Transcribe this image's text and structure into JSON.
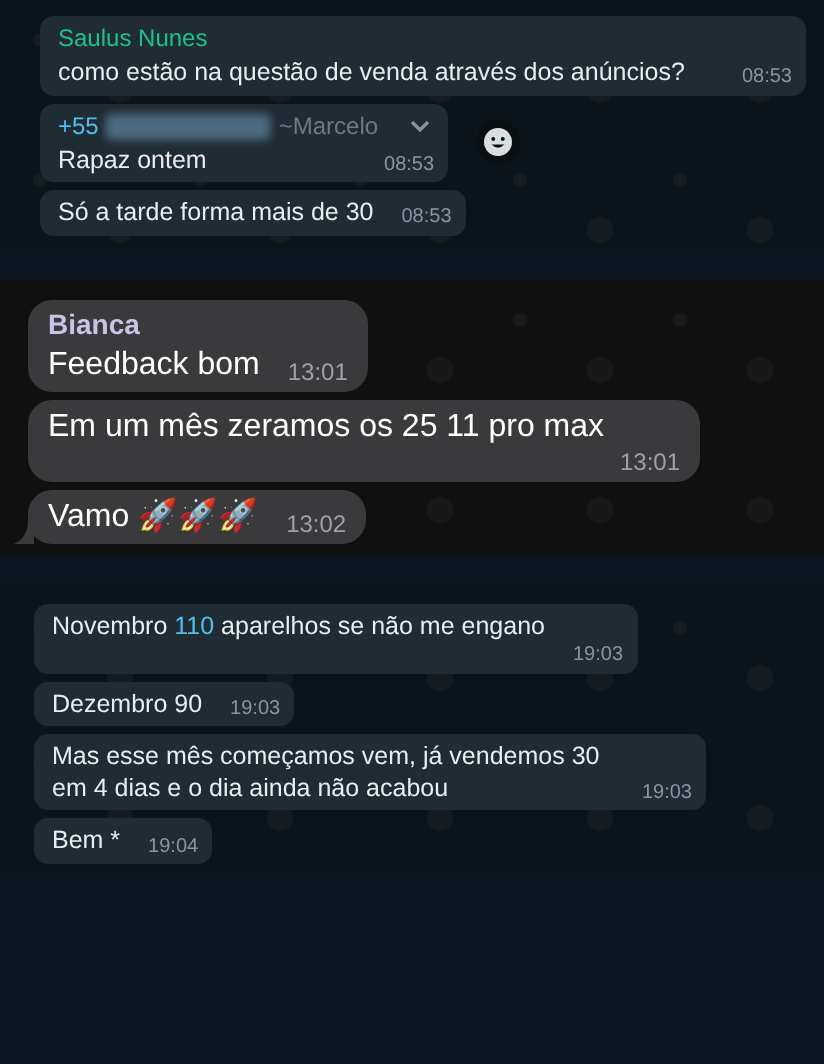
{
  "screenshots": [
    {
      "kind": "android",
      "messages": [
        {
          "sender": {
            "name": "Saulus Nunes",
            "color": "#21c08b"
          },
          "parts": [
            {
              "text": "como estão na questão de venda através dos anúncios?"
            }
          ],
          "time": "08:53",
          "wide": true
        },
        {
          "sender": {
            "name": "+55",
            "color": "#53bdeb",
            "redacted": true,
            "alias": "~Marcelo"
          },
          "parts": [
            {
              "text": "Rapaz ontem"
            }
          ],
          "time": "08:53",
          "menu": true,
          "reaction_button": true
        },
        {
          "parts": [
            {
              "text": "Só a tarde forma mais de 30"
            }
          ],
          "time": "08:53"
        }
      ]
    },
    {
      "kind": "ios",
      "messages": [
        {
          "sender": {
            "name": "Bianca",
            "color": "#c9c3e6"
          },
          "parts": [
            {
              "text": "Feedback bom"
            }
          ],
          "time": "13:01"
        },
        {
          "parts": [
            {
              "text": "Em um mês zeramos os 25 11 pro max"
            }
          ],
          "time": "13:01",
          "time_below": true
        },
        {
          "parts": [
            {
              "text": "Vamo 🚀🚀🚀"
            }
          ],
          "time": "13:02",
          "tail": true
        }
      ]
    },
    {
      "kind": "android",
      "messages": [
        {
          "parts": [
            {
              "text": "Novembro "
            },
            {
              "text": "110",
              "link": true
            },
            {
              "text": " aparelhos se não me engano"
            }
          ],
          "time": "19:03",
          "time_below": true
        },
        {
          "parts": [
            {
              "text": "Dezembro 90"
            }
          ],
          "time": "19:03"
        },
        {
          "parts": [
            {
              "text": "Mas esse mês começamos vem, já vendemos 30 em 4 dias e o dia ainda não acabou"
            }
          ],
          "time": "19:03"
        },
        {
          "parts": [
            {
              "text": "Bem *"
            }
          ],
          "time": "19:04"
        }
      ]
    }
  ]
}
